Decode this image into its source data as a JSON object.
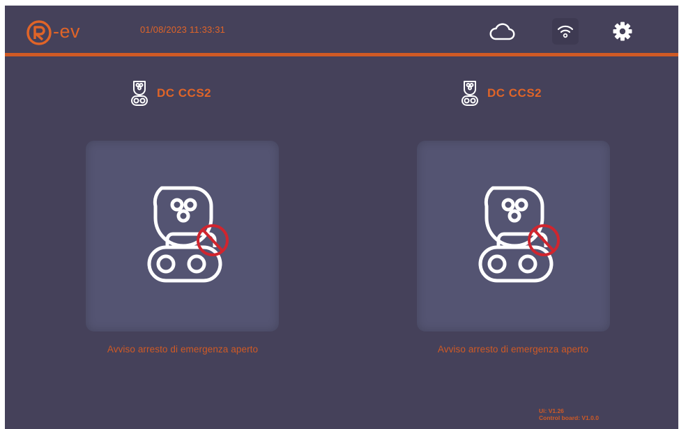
{
  "header": {
    "logo_text": "-ev",
    "datetime": "01/08/2023  11:33:31"
  },
  "connectors": [
    {
      "title": "DC CCS2",
      "alarm": "Avviso arresto di emergenza aperto"
    },
    {
      "title": "DC CCS2",
      "alarm": "Avviso arresto di emergenza aperto"
    }
  ],
  "footer": {
    "ui_version": "Ui: V1.26",
    "board_version": "Control board: V1.0.0"
  },
  "colors": {
    "background": "#45415a",
    "accent": "#e06428",
    "card": "#545472",
    "prohibited": "#d0252e"
  },
  "icons": {
    "logo": "r-logo-icon",
    "cloud": "cloud-icon",
    "wifi": "wifi-icon",
    "settings": "gear-icon",
    "connector": "ccs2-plug-icon",
    "prohibited": "prohibited-icon"
  }
}
